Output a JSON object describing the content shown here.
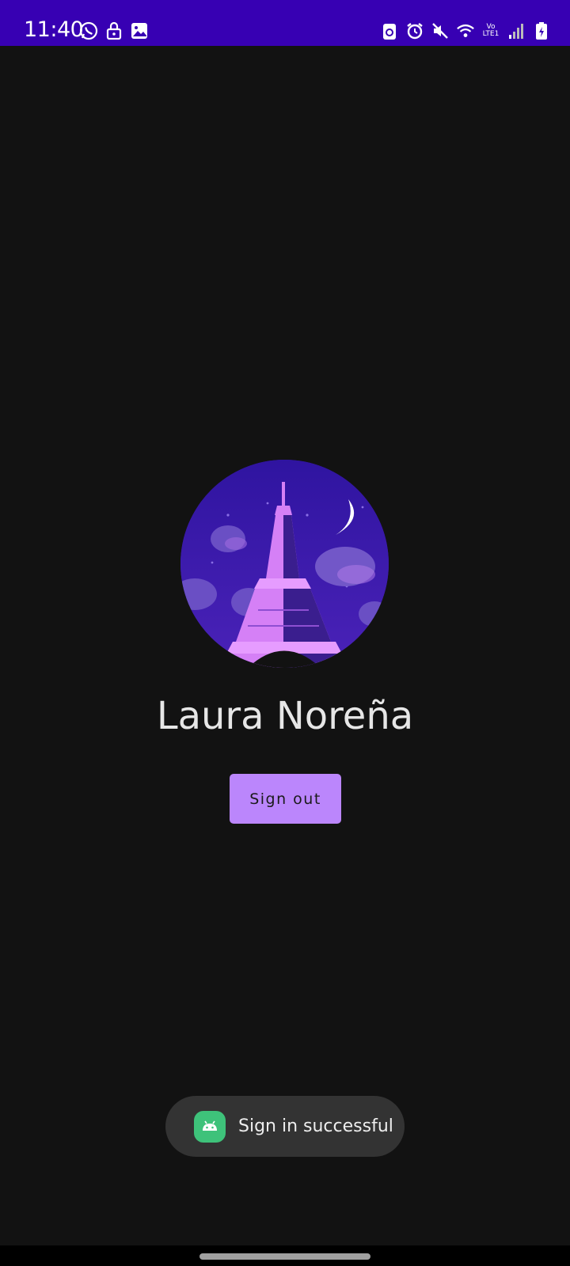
{
  "status_bar": {
    "time": "11:40",
    "network_label": "Vo LTE1",
    "left_icons": [
      "whatsapp-icon",
      "lock-icon",
      "gallery-icon"
    ],
    "right_icons": [
      "recycle-icon",
      "alarm-icon",
      "mute-icon",
      "wifi-icon",
      "volte-icon",
      "signal-icon",
      "battery-icon"
    ],
    "background": "#3700B3"
  },
  "profile": {
    "name": "Laura Noreña",
    "avatar": "eiffel-tower-night-avatar"
  },
  "actions": {
    "sign_out_label": "Sign out",
    "accent": "#BB86FC"
  },
  "toast": {
    "message": "Sign in successful",
    "icon": "android-icon"
  },
  "colors": {
    "background": "#121212",
    "name_text": "#E6E6E6"
  }
}
